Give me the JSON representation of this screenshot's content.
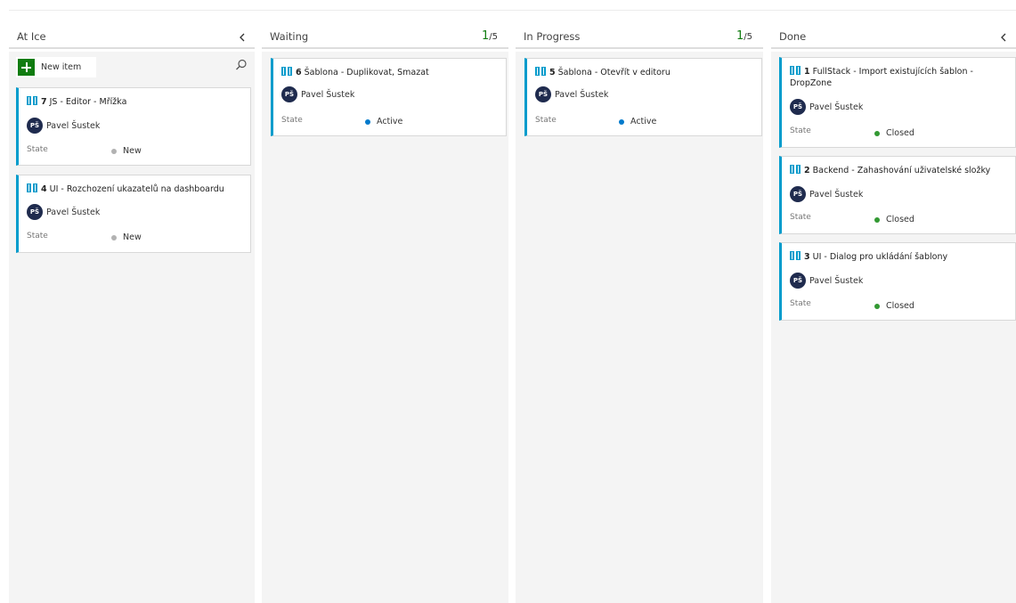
{
  "colors": {
    "accent_bar": "#009ccc",
    "wip_ok": "#107c10",
    "state_new": "#b2b2b2",
    "state_active": "#007acc",
    "state_closed": "#339933",
    "avatar_bg": "#1f2b4e"
  },
  "icons": {
    "card": "book-icon",
    "collapse": "chevron-left-icon",
    "search": "search-icon",
    "add": "plus-icon"
  },
  "columns": [
    {
      "title": "At Ice",
      "new_item_label": "New item",
      "cards": [
        {
          "id": "7",
          "title": "JS - Editor - Mřížka",
          "avatar": "PŠ",
          "assignee": "Pavel Šustek",
          "state_label": "State",
          "state": "New"
        },
        {
          "id": "4",
          "title": "UI - Rozchození ukazatelů na dashboardu",
          "avatar": "PŠ",
          "assignee": "Pavel Šustek",
          "state_label": "State",
          "state": "New"
        }
      ]
    },
    {
      "title": "Waiting",
      "count_current": "1",
      "count_limit": "/5",
      "cards": [
        {
          "id": "6",
          "title": "Šablona - Duplikovat, Smazat",
          "avatar": "PŠ",
          "assignee": "Pavel Šustek",
          "state_label": "State",
          "state": "Active"
        }
      ]
    },
    {
      "title": "In Progress",
      "count_current": "1",
      "count_limit": "/5",
      "cards": [
        {
          "id": "5",
          "title": "Šablona - Otevřít v editoru",
          "avatar": "PŠ",
          "assignee": "Pavel Šustek",
          "state_label": "State",
          "state": "Active"
        }
      ]
    },
    {
      "title": "Done",
      "cards": [
        {
          "id": "1",
          "title": "FullStack - Import existujících šablon - DropZone",
          "avatar": "PŠ",
          "assignee": "Pavel Šustek",
          "state_label": "State",
          "state": "Closed"
        },
        {
          "id": "2",
          "title": "Backend - Zahashování uživatelské složky",
          "avatar": "PŠ",
          "assignee": "Pavel Šustek",
          "state_label": "State",
          "state": "Closed"
        },
        {
          "id": "3",
          "title": "UI - Dialog pro ukládání šablony",
          "avatar": "PŠ",
          "assignee": "Pavel Šustek",
          "state_label": "State",
          "state": "Closed"
        }
      ]
    }
  ]
}
